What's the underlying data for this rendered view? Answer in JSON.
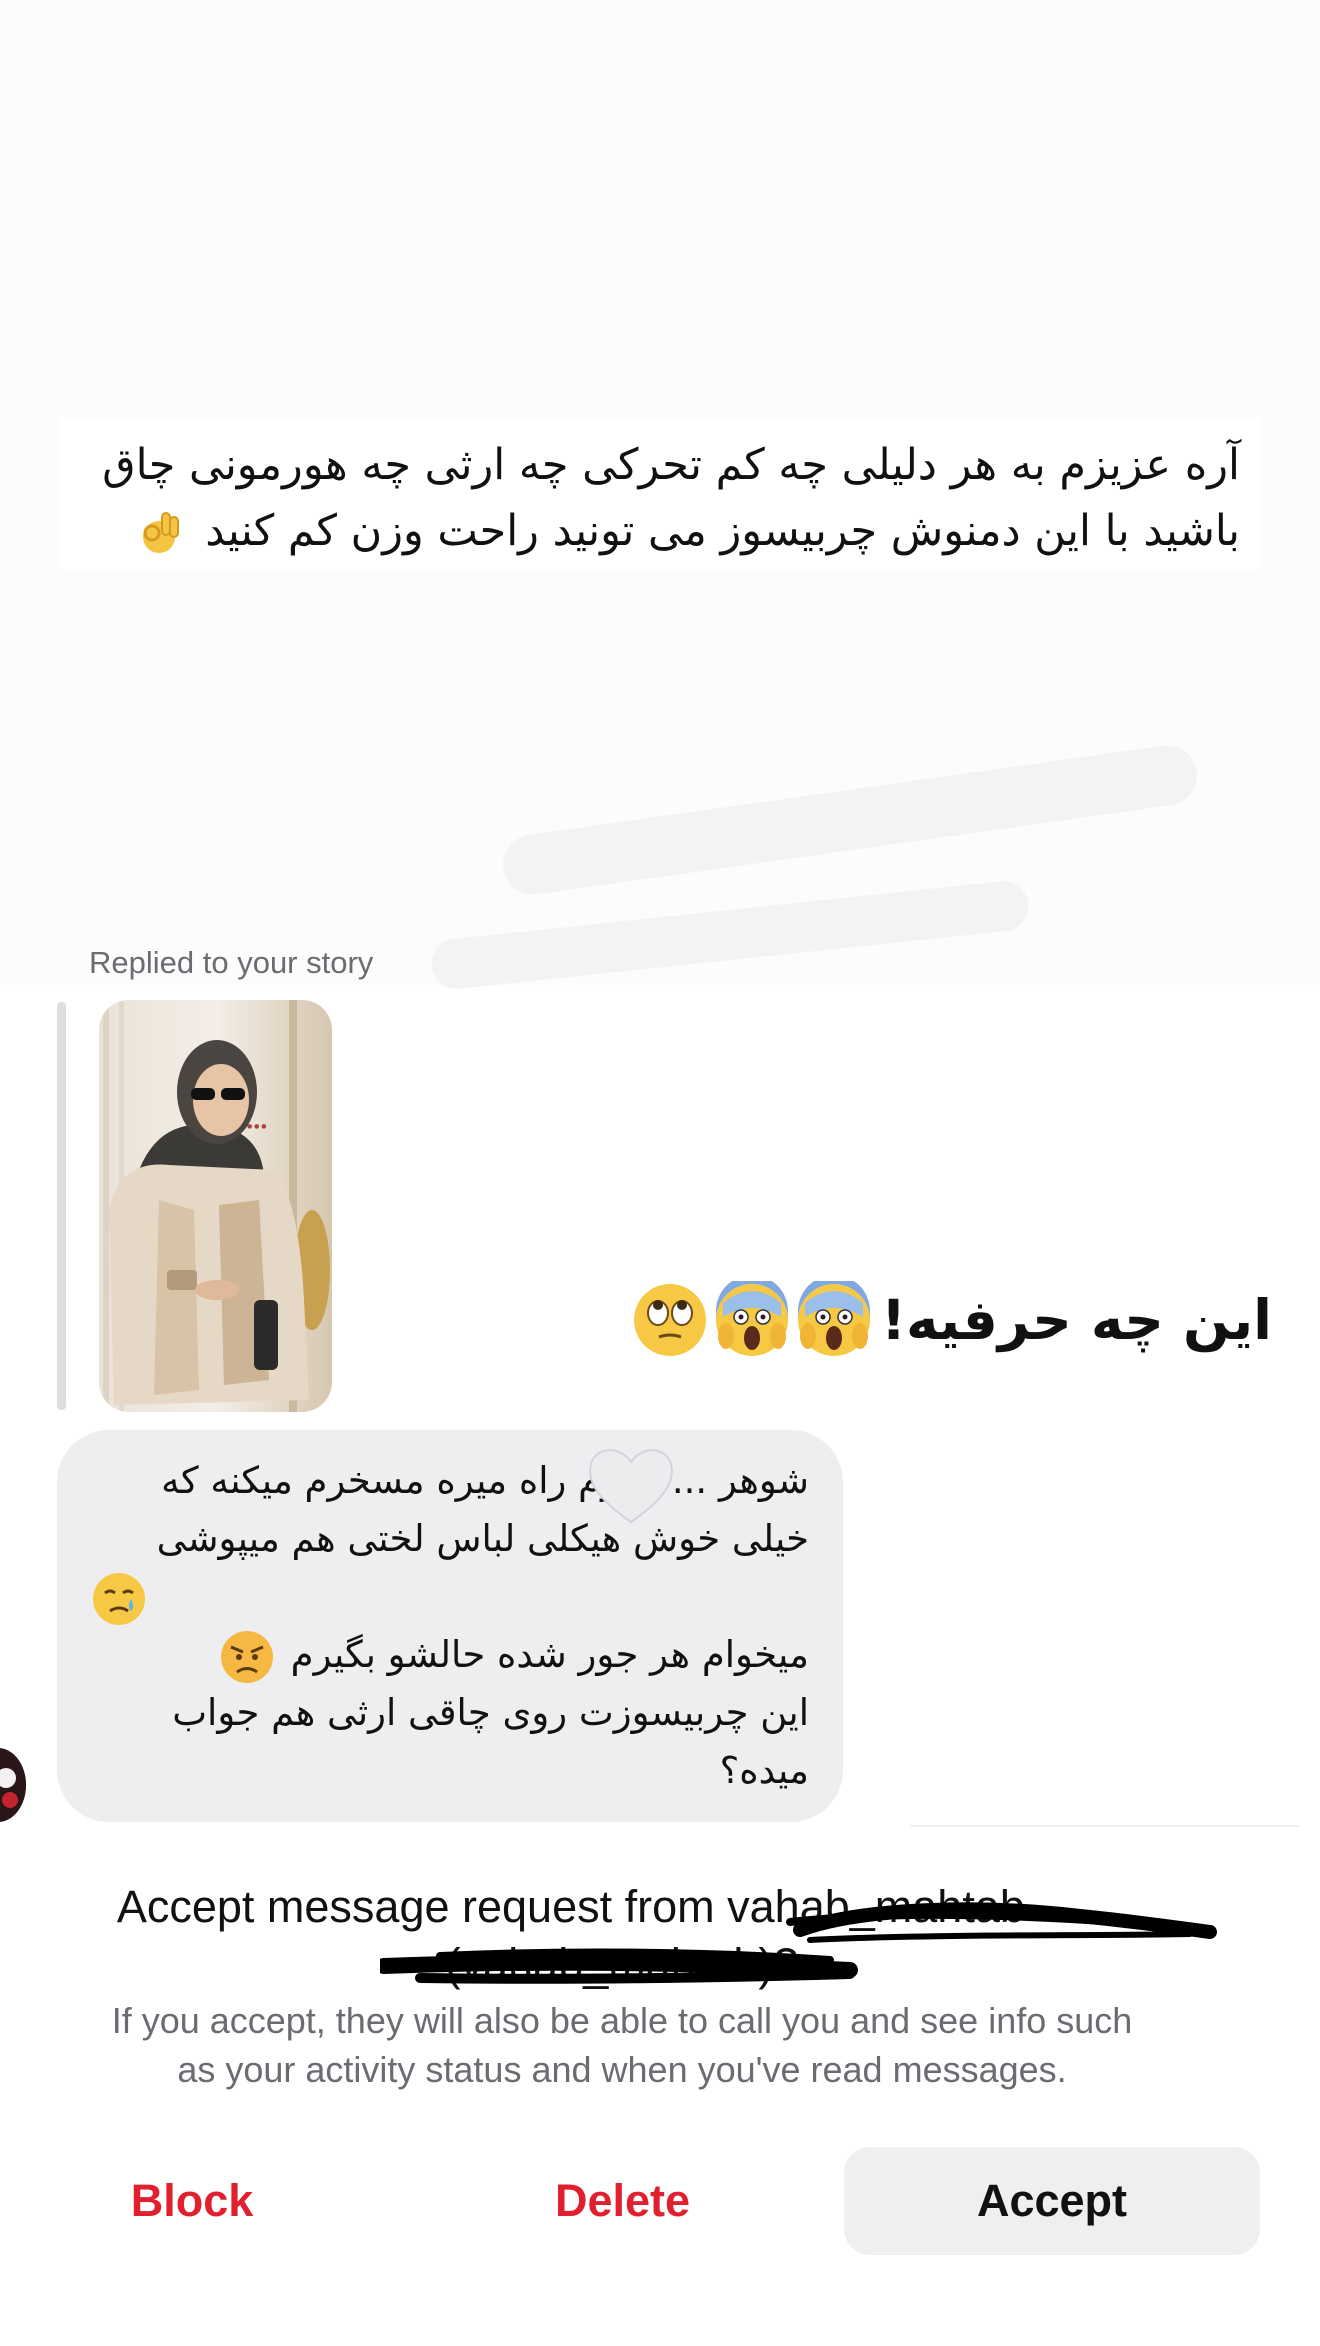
{
  "story": {
    "caption_line1": "آره عزیزم به هر دلیلی چه کم تحرکی چه ارثی چه هورمونی چاق",
    "caption_line2": "باشید با این دمنوش چربیسوز می تونید راحت وزن کم کنید",
    "replied_label": "Replied to your story"
  },
  "messages": {
    "sent_text": "این چه حرفیه!",
    "sent_emojis": [
      "screaming-face",
      "screaming-face",
      "eye-roll-face"
    ],
    "received_lines": [
      "شوهر ... عورم راه میره مسخرم میکنه که",
      "خیلی خوش هیکلی لباس لختی هم میپوشی",
      "",
      "میخوام هر جور شده حالشو بگیرم",
      "این چربیسوزت روی چاقی ارثی هم جواب",
      "میده؟"
    ]
  },
  "request": {
    "title_prefix": "Accept message request from",
    "title_username": "vahab_mahtab",
    "title_suffix": "(vahab_mahtab)?",
    "info_line1": "If you accept, they will also be able to call you and see info such",
    "info_line2": "as your activity status and when you've read messages."
  },
  "actions": {
    "block_label": "Block",
    "delete_label": "Delete",
    "accept_label": "Accept"
  },
  "colors": {
    "danger": "#e0202e",
    "muted_text": "#6b6b72",
    "bubble_bg": "#eeeef1"
  }
}
